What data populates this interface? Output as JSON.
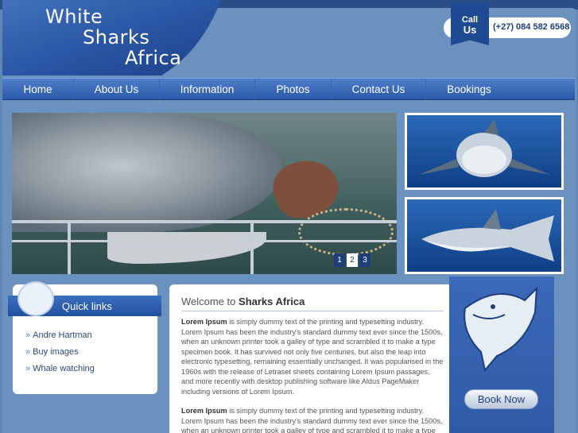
{
  "logo": {
    "line1": "White",
    "line2": "Sharks",
    "line3": "Africa"
  },
  "call": {
    "line1": "Call",
    "line2": "Us",
    "phone": "(+27) 084 582 6568"
  },
  "nav": [
    {
      "label": "Home"
    },
    {
      "label": "About Us"
    },
    {
      "label": "Information"
    },
    {
      "label": "Photos"
    },
    {
      "label": "Contact Us"
    },
    {
      "label": "Bookings"
    }
  ],
  "slider": {
    "pages": [
      "1",
      "2",
      "3"
    ],
    "active": "2"
  },
  "quick_links": {
    "title": "Quick links",
    "items": [
      "Andre Hartman",
      "Buy images",
      "Whale watching"
    ]
  },
  "content": {
    "title_prefix": "Welcome to",
    "title_name": "Sharks Africa",
    "para1_bold": "Lorem Ipsum",
    "para1": " is simply dummy text of the printing and typesetting industry. Lorem Ipsum has been the industry's standard dummy text ever since the 1500s, when an unknown printer took a galley of type and scrambled it to make a type specimen book. It has survived not only five centuries, but also the leap into electronic typesetting, remaining essentially unchanged. It was popularised in the 1960s with the release of Letraset sheets containing Lorem Ipsum passages, and more recently with desktop publishing software like Aldus PageMaker including versions of Lorem Ipsum.",
    "para2_bold": "Lorem Ipsum",
    "para2": " is simply dummy text of the printing and typesetting industry. Lorem Ipsum has been the industry's standard dummy text ever since the 1500s, when an unknown printer took a galley of type and scrambled it to make a type specimen"
  },
  "book_button": "Book Now",
  "colors": {
    "accent": "#2a57a6",
    "background": "#6b91bf"
  }
}
